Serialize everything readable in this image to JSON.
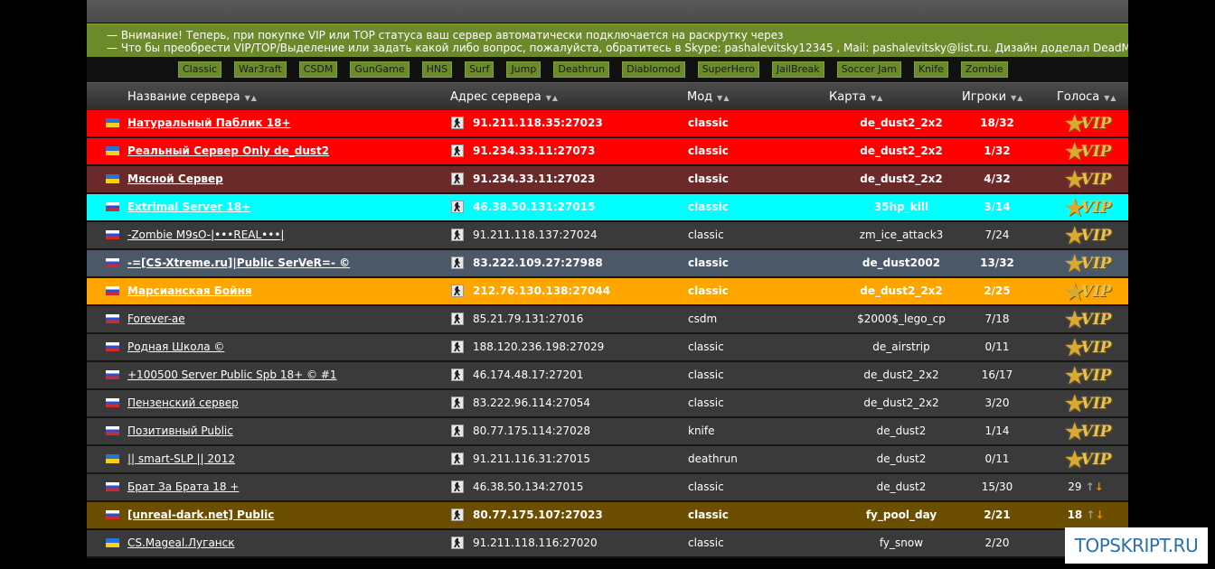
{
  "notice": {
    "line1": "— Внимание! Теперь, при покупке VIP или TOP статуса ваш сервер автоматически подключается на раскрутку через",
    "line2": "— Что бы преобрести VIP/TOP/Выделение или задать какой либо вопрос, пожалуйста, обратитесь в Skype: pashalevitsky12345 , Mail: pashalevitsky@list.ru. Дизайн доделал DeadMoras"
  },
  "mods": [
    "Classic",
    "War3raft",
    "CSDM",
    "GunGame",
    "HNS",
    "Surf",
    "Jump",
    "Deathrun",
    "Diablomod",
    "SuperHero",
    "JailBreak",
    "Soccer Jam",
    "Knife",
    "Zombie"
  ],
  "columns": {
    "name": "Название сервера",
    "address": "Адрес сервера",
    "mod": "Мод",
    "map": "Карта",
    "players": "Игроки",
    "votes": "Голоса"
  },
  "vip_label": "VIP",
  "colors": {
    "red": "#ff0000",
    "maroon": "#6b2a2a",
    "cyan": "#00ffff",
    "slate": "#4a5868",
    "orange": "#ffa500",
    "gold": "#6b4e00",
    "dark": "#3a3a3a"
  },
  "rows": [
    {
      "flag": "ua",
      "name": "Натуральный Паблик 18+",
      "address": "91.211.118.35:27023",
      "mod": "classic",
      "map": "de_dust2_2x2",
      "players": "18/32",
      "vote": "vip",
      "bg": "#ff0000",
      "bold": true
    },
    {
      "flag": "ua",
      "name": "Реальный Сервер Only de_dust2",
      "address": "91.234.33.11:27073",
      "mod": "classic",
      "map": "de_dust2_2x2",
      "players": "1/32",
      "vote": "vip",
      "bg": "#ff0000",
      "bold": true
    },
    {
      "flag": "ua",
      "name": "Мясной Сервер",
      "address": "91.234.33.11:27023",
      "mod": "classic",
      "map": "de_dust2_2x2",
      "players": "4/32",
      "vote": "vip",
      "bg": "#6b2a2a",
      "bold": true
    },
    {
      "flag": "ru",
      "name": "Extrimal Server 18+",
      "address": "46.38.50.131:27015",
      "mod": "classic",
      "map": "35hp_kill",
      "players": "3/14",
      "vote": "vip",
      "bg": "#00ffff",
      "bold": true
    },
    {
      "flag": "ru",
      "name": "-Zombie M9sO-|•••REAL•••|",
      "address": "91.211.118.137:27024",
      "mod": "classic",
      "map": "zm_ice_attack3",
      "players": "7/24",
      "vote": "vip",
      "bg": "#3a3a3a",
      "bold": false
    },
    {
      "flag": "ru",
      "name": "-=[CS-Xtreme.ru]|Public SerVeR=- ©",
      "address": "83.222.109.27:27988",
      "mod": "classic",
      "map": "de_dust2002",
      "players": "13/32",
      "vote": "vip",
      "bg": "#4a5868",
      "bold": true
    },
    {
      "flag": "ru",
      "name": "Марсианская Бойня",
      "address": "212.76.130.138:27044",
      "mod": "classic",
      "map": "de_dust2_2x2",
      "players": "2/25",
      "vote": "vip",
      "bg": "#ffa500",
      "bold": true
    },
    {
      "flag": "ru",
      "name": "Forever-ae",
      "address": "85.21.79.131:27016",
      "mod": "csdm",
      "map": "$2000$_lego_cp",
      "players": "7/18",
      "vote": "vip",
      "bg": "#3a3a3a",
      "bold": false
    },
    {
      "flag": "ru",
      "name": "Родная Школа ©",
      "address": "188.120.236.198:27029",
      "mod": "classic",
      "map": "de_airstrip",
      "players": "0/11",
      "vote": "vip",
      "bg": "#3a3a3a",
      "bold": false
    },
    {
      "flag": "ru",
      "name": "+100500 Server Public Spb 18+ © #1",
      "address": "46.174.48.17:27201",
      "mod": "classic",
      "map": "de_dust2_2x2",
      "players": "16/17",
      "vote": "vip",
      "bg": "#3a3a3a",
      "bold": false
    },
    {
      "flag": "ru",
      "name": "Пензенский сервер",
      "address": "83.222.96.114:27054",
      "mod": "classic",
      "map": "de_dust2_2x2",
      "players": "3/20",
      "vote": "vip",
      "bg": "#3a3a3a",
      "bold": false
    },
    {
      "flag": "ru",
      "name": "Позитивный Public",
      "address": "80.77.175.114:27028",
      "mod": "knife",
      "map": "de_dust2",
      "players": "1/14",
      "vote": "vip",
      "bg": "#3a3a3a",
      "bold": false
    },
    {
      "flag": "ua",
      "name": "|| smart-SLP || 2012",
      "address": "91.211.116.31:27015",
      "mod": "deathrun",
      "map": "de_dust2",
      "players": "0/11",
      "vote": "vip",
      "bg": "#3a3a3a",
      "bold": false
    },
    {
      "flag": "ru",
      "name": "Брат За Брата 18 +",
      "address": "46.38.50.134:27015",
      "mod": "classic",
      "map": "de_dust2",
      "players": "15/30",
      "vote": "29",
      "bg": "#3a3a3a",
      "bold": false
    },
    {
      "flag": "ru",
      "name": "[unreal-dark.net] Public",
      "address": "80.77.175.107:27023",
      "mod": "classic",
      "map": "fy_pool_day",
      "players": "2/21",
      "vote": "18",
      "bg": "#6b4e00",
      "bold": true
    },
    {
      "flag": "ua",
      "name": "CS.Mageal.Луганск",
      "address": "91.211.118.116:27020",
      "mod": "classic",
      "map": "fy_snow",
      "players": "2/20",
      "vote": "",
      "bg": "#3a3a3a",
      "bold": false
    }
  ],
  "watermark": "TOPSKRIPT.RU"
}
